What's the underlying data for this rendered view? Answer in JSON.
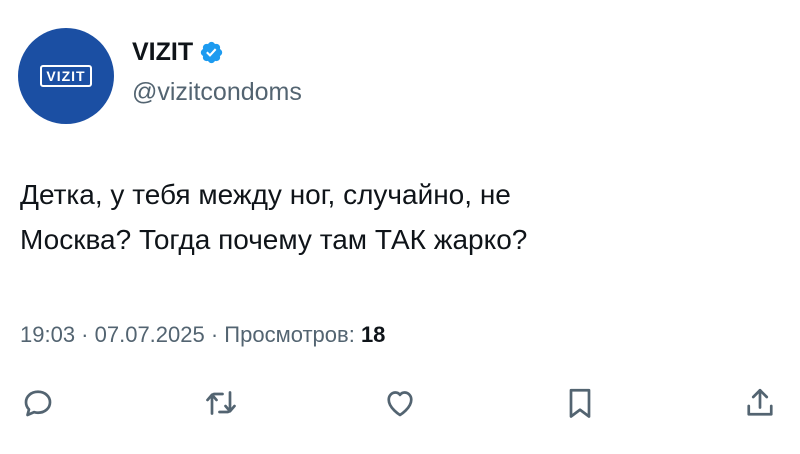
{
  "author": {
    "display_name": "VIZIT",
    "handle": "@vizitcondoms",
    "avatar_text": "VIZIT",
    "verified": true
  },
  "tweet": {
    "line1": "Детка, у тебя между ног, случайно, не",
    "line2": "Москва? Тогда почему там ТАК жарко?"
  },
  "meta": {
    "time": "19:03",
    "separator": " · ",
    "date": "07.07.2025",
    "views_label": "Просмотров:",
    "views_count": "18"
  },
  "actions": [
    "reply-icon",
    "retweet-icon",
    "like-icon",
    "bookmark-icon",
    "share-icon"
  ],
  "colors": {
    "avatar_bg": "#1b4fa3",
    "verified": "#1d9bf0",
    "secondary_text": "#536471",
    "primary_text": "#0f1419"
  }
}
